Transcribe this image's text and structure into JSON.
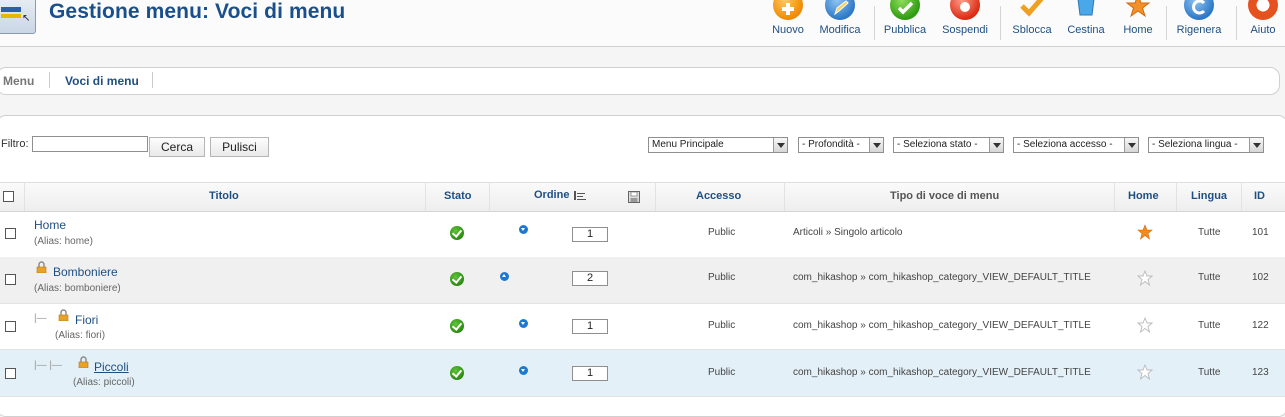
{
  "header": {
    "title": "Gestione menu: Voci di menu",
    "toolbar": [
      {
        "label": "Nuovo",
        "icon": "new-icon"
      },
      {
        "label": "Modifica",
        "icon": "edit-icon"
      },
      {
        "label": "Pubblica",
        "icon": "publish-icon"
      },
      {
        "label": "Sospendi",
        "icon": "unpublish-icon"
      },
      {
        "label": "Sblocca",
        "icon": "checkin-icon"
      },
      {
        "label": "Cestina",
        "icon": "trash-icon"
      },
      {
        "label": "Home",
        "icon": "home-star-icon"
      },
      {
        "label": "Rigenera",
        "icon": "refresh-icon"
      },
      {
        "label": "Aiuto",
        "icon": "help-icon"
      }
    ]
  },
  "submenu": {
    "items": [
      {
        "label": "Menu",
        "active": false
      },
      {
        "label": "Voci di menu",
        "active": true
      }
    ]
  },
  "filter": {
    "label": "Filtro:",
    "value": "",
    "search_label": "Cerca",
    "clear_label": "Pulisci",
    "selects": [
      "Menu Principale",
      "- Profondità -",
      "- Seleziona stato -",
      "- Seleziona accesso -",
      "- Seleziona lingua -"
    ]
  },
  "table": {
    "columns": {
      "title": "Titolo",
      "status": "Stato",
      "ordering": "Ordine",
      "access": "Accesso",
      "type": "Tipo di voce di menu",
      "home": "Home",
      "language": "Lingua",
      "id": "ID"
    },
    "alias_prefix": "(Alias:",
    "rows": [
      {
        "title": "Home",
        "alias": "home",
        "status": "published",
        "order": "1",
        "order_arrow": "down",
        "access": "Public",
        "type": "Articoli » Singolo articolo",
        "home": true,
        "language": "Tutte",
        "id": "101",
        "locked": false,
        "level": 0
      },
      {
        "title": "Bomboniere",
        "alias": "bomboniere",
        "status": "published",
        "order": "2",
        "order_arrow": "up",
        "access": "Public",
        "type": "com_hikashop » com_hikashop_category_VIEW_DEFAULT_TITLE",
        "home": false,
        "language": "Tutte",
        "id": "102",
        "locked": true,
        "level": 0
      },
      {
        "title": "Fiori",
        "alias": "fiori",
        "status": "published",
        "order": "1",
        "order_arrow": "down",
        "access": "Public",
        "type": "com_hikashop » com_hikashop_category_VIEW_DEFAULT_TITLE",
        "home": false,
        "language": "Tutte",
        "id": "122",
        "locked": true,
        "level": 1
      },
      {
        "title": "Piccoli",
        "alias": "piccoli",
        "status": "published",
        "order": "1",
        "order_arrow": "down",
        "access": "Public",
        "type": "com_hikashop » com_hikashop_category_VIEW_DEFAULT_TITLE",
        "home": false,
        "language": "Tutte",
        "id": "123",
        "locked": true,
        "level": 2
      }
    ]
  }
}
